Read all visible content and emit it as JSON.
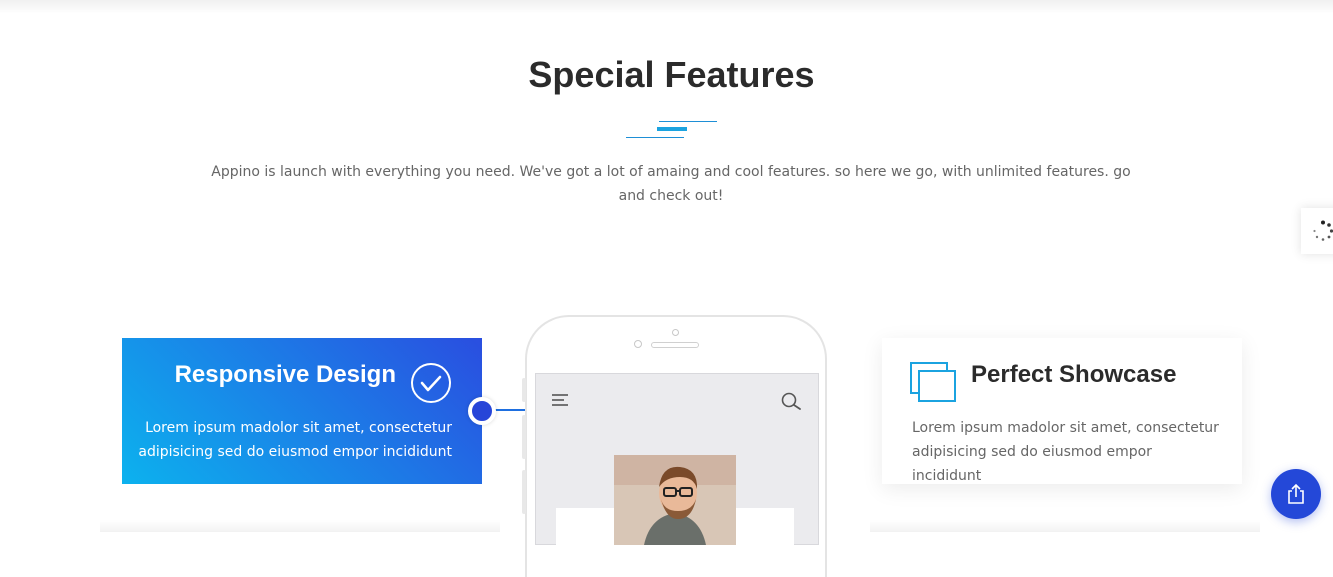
{
  "section": {
    "title": "Special Features",
    "description": "Appino is launch with everything you need. We've got a lot of amaing and cool features. so here we go, with unlimited features. go and check out!"
  },
  "features": {
    "left": {
      "title": "Responsive Design",
      "text": "Lorem ipsum madolor sit amet, consectetur adipisicing sed do eiusmod empor incididunt",
      "icon": "check-circle-icon"
    },
    "right": {
      "title": "Perfect Showcase",
      "text": "Lorem ipsum madolor sit amet, consectetur adipisicing sed do eiusmod empor incididunt",
      "icon": "showcase-windows-icon"
    }
  },
  "phone_mockup": {
    "menu_icon": "hamburger-menu-icon",
    "search_icon": "search-icon"
  },
  "colors": {
    "accent_blue": "#2a4ee0",
    "accent_cyan": "#0cb2ee",
    "title_text": "#2b2b2b",
    "body_text": "#666666"
  },
  "widgets": {
    "loading_icon": "loading-spinner-icon",
    "share_icon": "share-icon"
  }
}
